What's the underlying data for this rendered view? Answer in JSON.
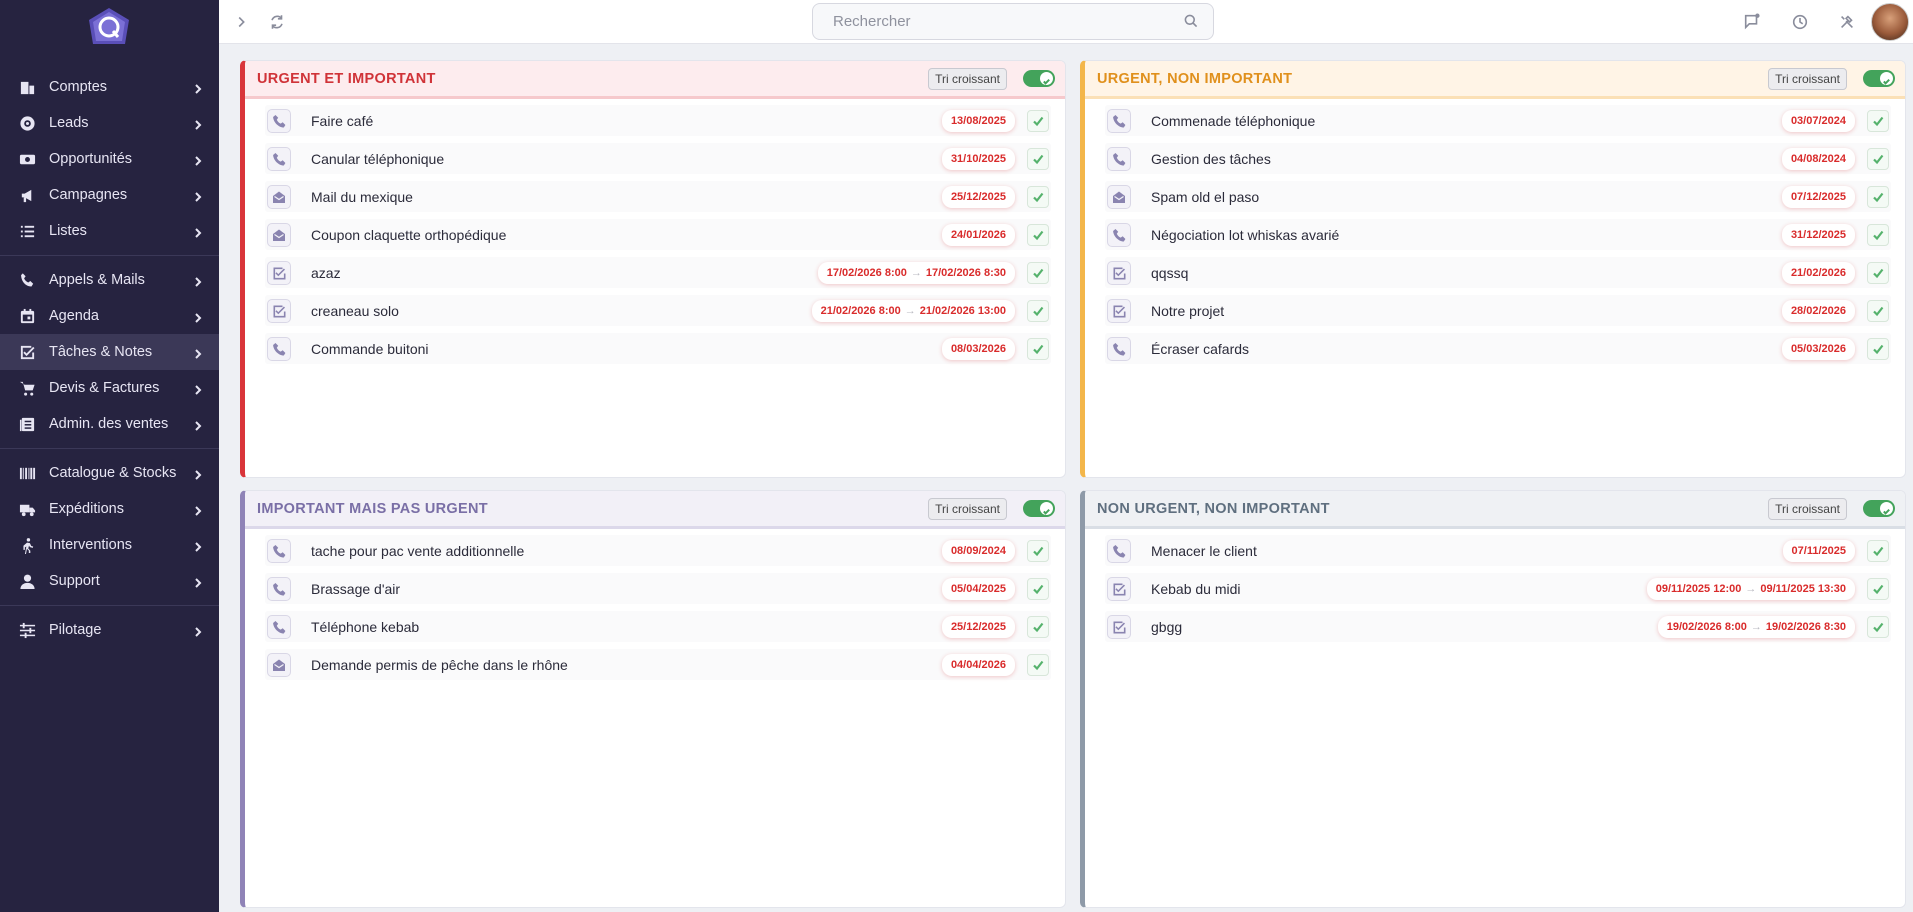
{
  "search": {
    "placeholder": "Rechercher"
  },
  "colors": {
    "sidebar_bg": "#262340",
    "urgent_important": "#d9353a",
    "urgent_non_important": "#f3b64a",
    "important_non_urgent": "#8f83b7",
    "non_urgent": "#8e9aa8",
    "date_red": "#d92b2b",
    "check_green": "#55b26c"
  },
  "sidebar": {
    "groups": [
      [
        {
          "label": "Comptes",
          "icon": "building-icon"
        },
        {
          "label": "Leads",
          "icon": "target-icon"
        },
        {
          "label": "Opportunités",
          "icon": "money-icon"
        },
        {
          "label": "Campagnes",
          "icon": "megaphone-icon"
        },
        {
          "label": "Listes",
          "icon": "list-icon"
        }
      ],
      [
        {
          "label": "Appels & Mails",
          "icon": "phone-icon"
        },
        {
          "label": "Agenda",
          "icon": "calendar-icon"
        },
        {
          "label": "Tâches & Notes",
          "icon": "task-icon",
          "active": true
        },
        {
          "label": "Devis & Factures",
          "icon": "cart-icon"
        },
        {
          "label": "Admin. des ventes",
          "icon": "ledger-icon"
        }
      ],
      [
        {
          "label": "Catalogue & Stocks",
          "icon": "barcode-icon"
        },
        {
          "label": "Expéditions",
          "icon": "truck-icon"
        },
        {
          "label": "Interventions",
          "icon": "walker-icon"
        },
        {
          "label": "Support",
          "icon": "person-icon"
        }
      ],
      [
        {
          "label": "Pilotage",
          "icon": "sliders-icon"
        }
      ]
    ]
  },
  "panels": [
    {
      "key": "urgent-important",
      "title": "URGENT ET IMPORTANT",
      "sort_label": "Tri croissant",
      "items": [
        {
          "type": "phone",
          "label": "Faire café",
          "date": "13/08/2025"
        },
        {
          "type": "phone",
          "label": "Canular téléphonique",
          "date": "31/10/2025"
        },
        {
          "type": "mail",
          "label": "Mail du mexique",
          "date": "25/12/2025"
        },
        {
          "type": "mail",
          "label": "Coupon claquette orthopédique",
          "date": "24/01/2026"
        },
        {
          "type": "task",
          "label": "azaz",
          "date": "17/02/2026 8:00",
          "date_end": "17/02/2026 8:30"
        },
        {
          "type": "task",
          "label": "creaneau solo",
          "date": "21/02/2026 8:00",
          "date_end": "21/02/2026 13:00"
        },
        {
          "type": "phone",
          "label": "Commande buitoni",
          "date": "08/03/2026"
        }
      ]
    },
    {
      "key": "urgent-non-important",
      "title": "URGENT, NON IMPORTANT",
      "sort_label": "Tri croissant",
      "items": [
        {
          "type": "phone",
          "label": "Commenade téléphonique",
          "date": "03/07/2024"
        },
        {
          "type": "phone",
          "label": "Gestion des tâches",
          "date": "04/08/2024"
        },
        {
          "type": "mail",
          "label": "Spam old el paso",
          "date": "07/12/2025"
        },
        {
          "type": "phone",
          "label": "Négociation lot whiskas avarié",
          "date": "31/12/2025"
        },
        {
          "type": "task",
          "label": "qqssq",
          "date": "21/02/2026"
        },
        {
          "type": "task",
          "label": "Notre projet",
          "date": "28/02/2026"
        },
        {
          "type": "phone",
          "label": "Écraser cafards",
          "date": "05/03/2026"
        }
      ]
    },
    {
      "key": "important-non-urgent",
      "title": "IMPORTANT MAIS PAS URGENT",
      "sort_label": "Tri croissant",
      "items": [
        {
          "type": "phone",
          "label": "tache pour pac vente additionnelle",
          "date": "08/09/2024"
        },
        {
          "type": "phone",
          "label": "Brassage d'air",
          "date": "05/04/2025"
        },
        {
          "type": "phone",
          "label": "Téléphone kebab",
          "date": "25/12/2025"
        },
        {
          "type": "mail",
          "label": "Demande permis de pêche dans le rhône",
          "date": "04/04/2026"
        }
      ]
    },
    {
      "key": "non-urgent-non-important",
      "title": "NON URGENT, NON IMPORTANT",
      "sort_label": "Tri croissant",
      "items": [
        {
          "type": "phone",
          "label": "Menacer le client",
          "date": "07/11/2025"
        },
        {
          "type": "task",
          "label": "Kebab du midi",
          "date": "09/11/2025 12:00",
          "date_end": "09/11/2025 13:30"
        },
        {
          "type": "task",
          "label": "gbgg",
          "date": "19/02/2026 8:00",
          "date_end": "19/02/2026 8:30"
        }
      ]
    }
  ]
}
